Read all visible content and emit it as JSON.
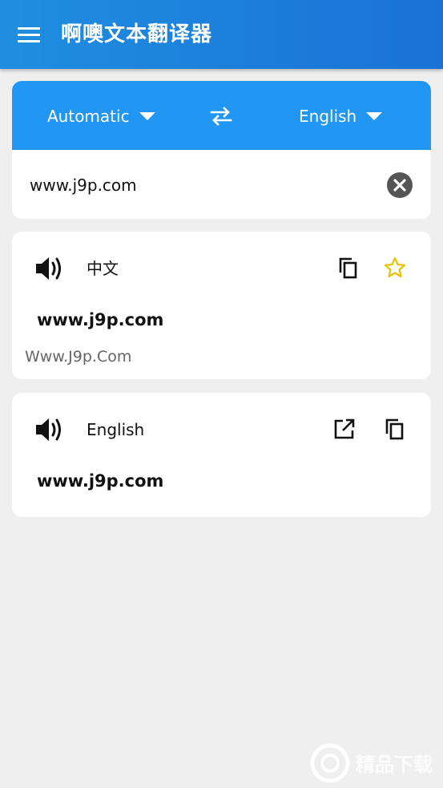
{
  "app_bar": {
    "title": "啊噢文本翻译器"
  },
  "input_card": {
    "source_lang": "Automatic",
    "target_lang": "English",
    "input_text": "www.j9p.com"
  },
  "results": [
    {
      "language": "中文",
      "text": "www.j9p.com",
      "transliteration": "Www.J9p.Com"
    },
    {
      "language": "English",
      "text": "www.j9p.com"
    }
  ],
  "watermark": {
    "text": "精品下载"
  },
  "colors": {
    "primary": "#2196f3",
    "appbar_start": "#1f8ee0",
    "appbar_end": "#1a72d6",
    "star": "#e6c200",
    "background": "#efefef"
  }
}
